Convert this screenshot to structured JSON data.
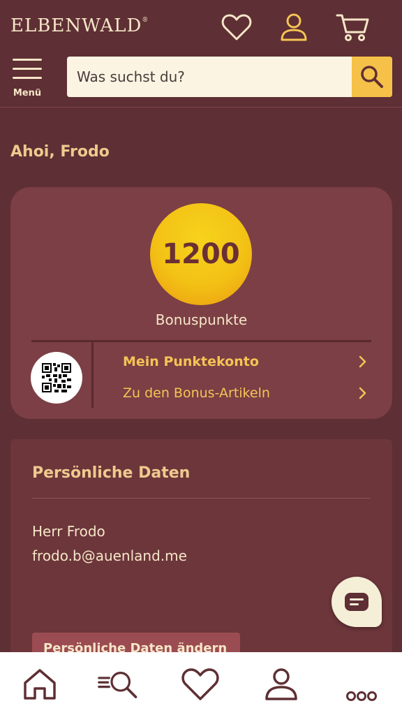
{
  "header": {
    "logo": "ELBENWALD",
    "logo_mark": "®",
    "menu_label": "Menü",
    "search_placeholder": "Was suchst du?",
    "icons": [
      "heart-icon",
      "user-icon",
      "cart-icon",
      "search-icon",
      "hamburger-icon"
    ]
  },
  "greeting": "Ahoi, Frodo",
  "bonus": {
    "points": "1200",
    "points_label": "Bonuspunkte",
    "links": [
      {
        "label": "Mein Punktekonto"
      },
      {
        "label": "Zu den Bonus-Artikeln"
      }
    ]
  },
  "personal": {
    "title": "Persönliche Daten",
    "name": "Herr Frodo",
    "email": "frodo.b@auenland.me",
    "button": "Persönliche Daten ändern"
  },
  "bottom_nav": {
    "icons": [
      "home-icon",
      "search-list-icon",
      "heart-icon",
      "user-icon",
      "more-icon"
    ]
  },
  "colors": {
    "background": "#5e2f34",
    "card": "#7b3f45",
    "accent_yellow": "#f5c455",
    "heading": "#f0c98e",
    "text": "#f6e6c8"
  }
}
